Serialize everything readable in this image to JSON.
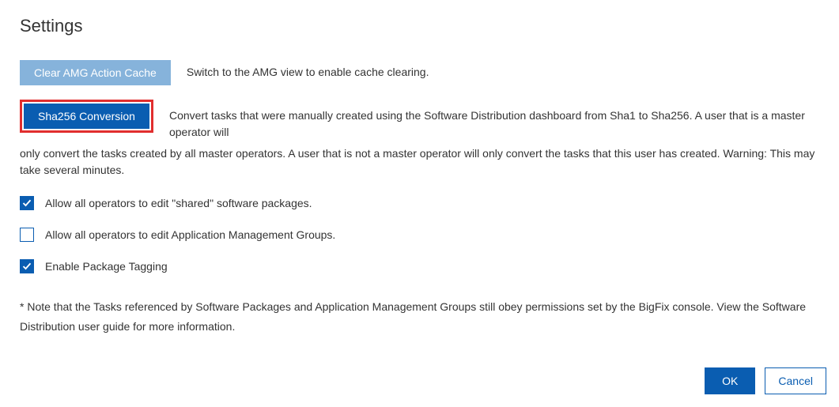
{
  "title": "Settings",
  "clearCache": {
    "button": "Clear AMG Action Cache",
    "desc": "Switch to the AMG view to enable cache clearing."
  },
  "shaConversion": {
    "button": "Sha256 Conversion",
    "descTop": "Convert tasks that were manually created using the Software Distribution dashboard from Sha1 to Sha256. A user that is a master operator will",
    "descCont": "only convert the tasks created by all master operators. A user that is not a master operator will only convert the tasks that this user has created. Warning: This may take several minutes."
  },
  "checkboxes": {
    "sharedPackages": {
      "label": "Allow all operators to edit \"shared\" software packages.",
      "checked": true
    },
    "appManagementGroups": {
      "label": "Allow all operators to edit Application Management Groups.",
      "checked": false
    },
    "packageTagging": {
      "label": "Enable Package Tagging",
      "checked": true
    }
  },
  "note": "* Note that the Tasks referenced by Software Packages and Application Management Groups still obey permissions set by the BigFix console. View the Software Distribution user guide for more information.",
  "footer": {
    "ok": "OK",
    "cancel": "Cancel"
  }
}
